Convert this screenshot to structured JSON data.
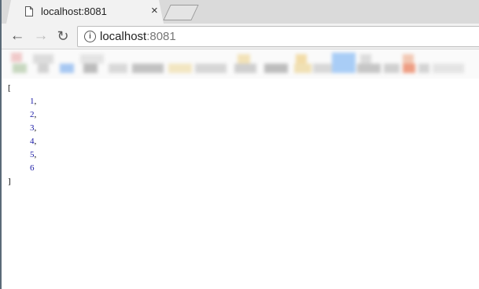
{
  "tab": {
    "title": "localhost:8081",
    "close": "×"
  },
  "toolbar": {
    "back": "←",
    "forward": "→",
    "reload": "↻"
  },
  "address": {
    "host": "localhost",
    "port": ":8081"
  },
  "json_view": {
    "open": "[",
    "items": [
      {
        "value": "1",
        "sep": ","
      },
      {
        "value": "2",
        "sep": ","
      },
      {
        "value": "3",
        "sep": ","
      },
      {
        "value": "4",
        "sep": ","
      },
      {
        "value": "5",
        "sep": ","
      },
      {
        "value": "6",
        "sep": ""
      }
    ],
    "close": "]"
  },
  "bookmark_blur_colors": [
    "#e9c7c7",
    "#c9d9c9",
    "#a9c9f4",
    "#b8b8b8",
    "#e9e2c5",
    "#f5e6b8",
    "#d4d4d4",
    "#a9cdf6",
    "#f0a890",
    "#e8e8e8"
  ]
}
